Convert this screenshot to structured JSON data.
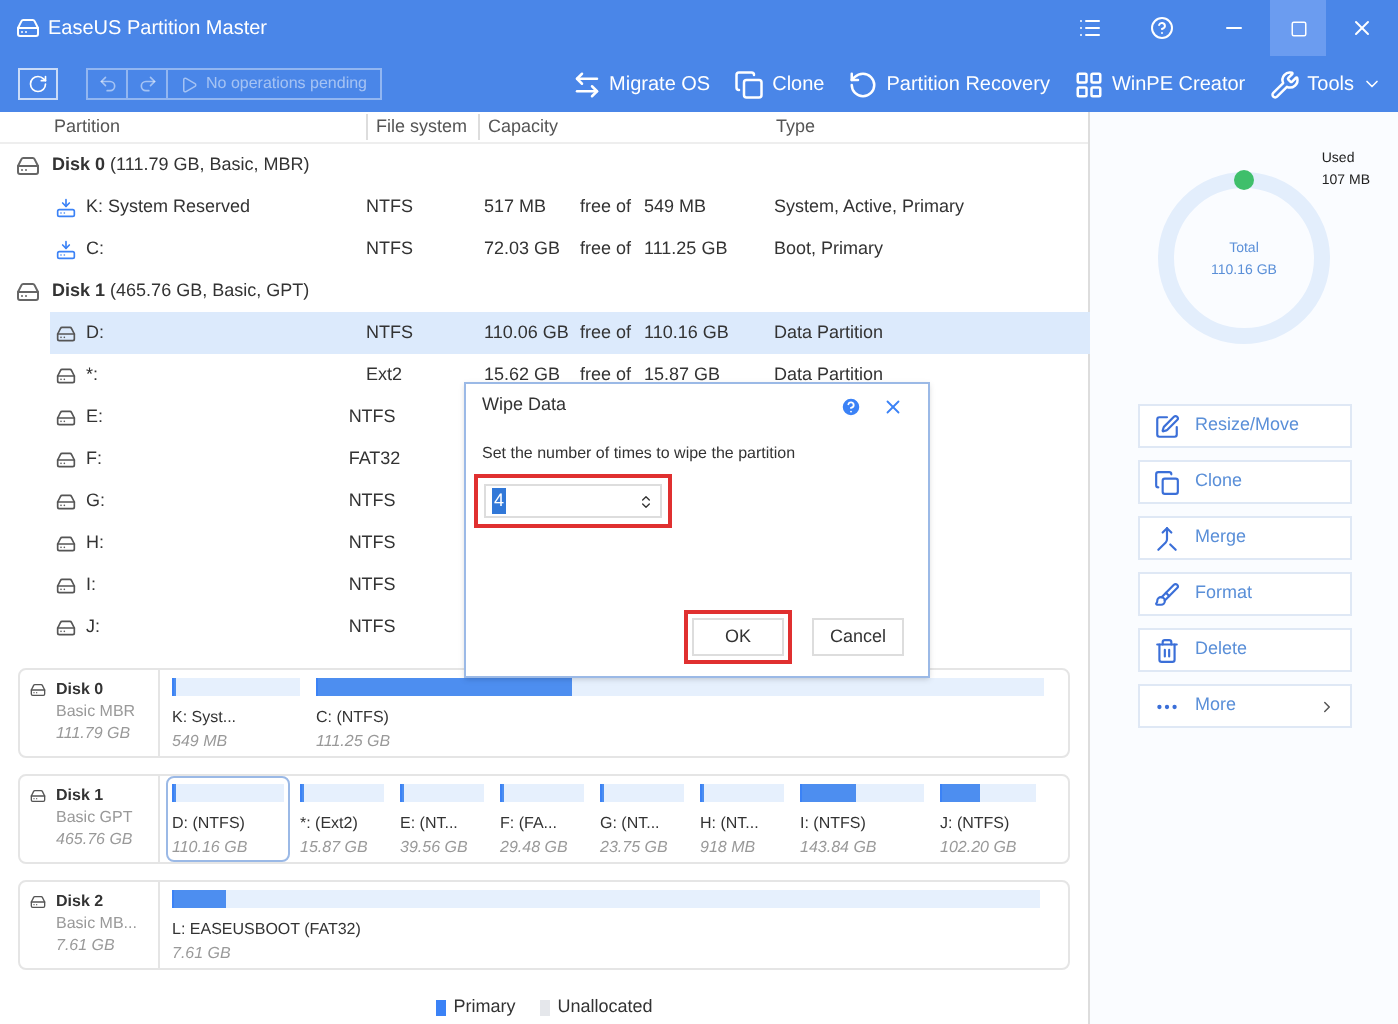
{
  "window": {
    "title": "EaseUS Partition Master"
  },
  "toolbar": {
    "status": "No operations pending",
    "actions": [
      {
        "label": "Migrate OS",
        "kind": "migrate"
      },
      {
        "label": "Clone",
        "kind": "clone"
      },
      {
        "label": "Partition Recovery",
        "kind": "recovery"
      },
      {
        "label": "WinPE Creator",
        "kind": "winpe"
      },
      {
        "label": "Tools",
        "kind": "tools"
      }
    ]
  },
  "table": {
    "columns": [
      "Partition",
      "File system",
      "Capacity",
      "Type"
    ],
    "disks": [
      {
        "name": "Disk 0",
        "info": "(111.79 GB, Basic, MBR)",
        "partitions": [
          {
            "name": "K: System Reserved",
            "kind": "system",
            "fs": "NTFS",
            "free": "517 MB",
            "free_of": "free of",
            "total": "549 MB",
            "type": "System, Active, Primary",
            "selected": false
          },
          {
            "name": "C:",
            "kind": "system",
            "fs": "NTFS",
            "free": "72.03 GB",
            "free_of": "free of",
            "total": "111.25 GB",
            "type": "Boot, Primary",
            "selected": false
          }
        ]
      },
      {
        "name": "Disk 1",
        "info": "(465.76 GB, Basic, GPT)",
        "partitions": [
          {
            "name": "D:",
            "kind": "drive",
            "fs": "NTFS",
            "free": "110.06 GB",
            "free_of": "free of",
            "total": "110.16 GB",
            "type": "Data Partition",
            "selected": true
          },
          {
            "name": "*:",
            "kind": "drive",
            "fs": "Ext2",
            "free": "15.62 GB",
            "free_of": "free of",
            "total": "15.87 GB",
            "type": "Data Partition",
            "selected": false
          },
          {
            "name": "E:",
            "kind": "drive",
            "fs": "NTFS",
            "selected": false
          },
          {
            "name": "F:",
            "kind": "drive",
            "fs": "FAT32",
            "selected": false
          },
          {
            "name": "G:",
            "kind": "drive",
            "fs": "NTFS",
            "selected": false
          },
          {
            "name": "H:",
            "kind": "drive",
            "fs": "NTFS",
            "selected": false
          },
          {
            "name": "I:",
            "kind": "drive",
            "fs": "NTFS",
            "selected": false
          },
          {
            "name": "J:",
            "kind": "drive",
            "fs": "NTFS",
            "selected": false
          }
        ]
      }
    ]
  },
  "dialog": {
    "title": "Wipe Data",
    "prompt": "Set the number of times to wipe the partition",
    "value": "4",
    "buttons": [
      "OK",
      "Cancel"
    ]
  },
  "disk_map": [
    {
      "name": "Disk 0",
      "style": "Basic MBR",
      "size": "111.79 GB",
      "partitions": [
        {
          "label": "K: Syst...",
          "size": "549 MB",
          "level": 0.02,
          "selected": false
        },
        {
          "label": "C:  (NTFS)",
          "size": "111.25 GB",
          "level": 0.35,
          "selected": false
        }
      ]
    },
    {
      "name": "Disk 1",
      "style": "Basic GPT",
      "size": "465.76 GB",
      "partitions": [
        {
          "label": "D:  (NTFS)",
          "size": "110.16 GB",
          "level": 0.005,
          "selected": true
        },
        {
          "label": "*:  (Ext2)",
          "size": "15.87 GB",
          "level": 0.01,
          "selected": false
        },
        {
          "label": "E:  (NT...",
          "size": "39.56 GB",
          "level": 0.01,
          "selected": false
        },
        {
          "label": "F:  (FA...",
          "size": "29.48 GB",
          "level": 0.01,
          "selected": false
        },
        {
          "label": "G:  (NT...",
          "size": "23.75 GB",
          "level": 0.01,
          "selected": false
        },
        {
          "label": "H:  (NT...",
          "size": "918 MB",
          "level": 0.01,
          "selected": false
        },
        {
          "label": "I:  (NTFS)",
          "size": "143.84 GB",
          "level": 0.45,
          "selected": false
        },
        {
          "label": "J:  (NTFS)",
          "size": "102.20 GB",
          "level": 0.4,
          "selected": false
        }
      ]
    },
    {
      "name": "Disk 2",
      "style": "Basic MB...",
      "size": "7.61 GB",
      "partitions": [
        {
          "label": "L: EASEUSBOOT (FAT32)",
          "size": "7.61 GB",
          "level": 0.06,
          "selected": false
        }
      ]
    }
  ],
  "legend": [
    {
      "label": "Primary",
      "color": "#3b82f6"
    },
    {
      "label": "Unallocated",
      "color": "#e5e7eb"
    }
  ],
  "usage": {
    "used_label": "Used",
    "used": "107 MB",
    "total_label": "Total",
    "total": "110.16 GB"
  },
  "operations": [
    {
      "label": "Resize/Move",
      "kind": "resize"
    },
    {
      "label": "Clone",
      "kind": "clone"
    },
    {
      "label": "Merge",
      "kind": "merge"
    },
    {
      "label": "Format",
      "kind": "format"
    },
    {
      "label": "Delete",
      "kind": "delete"
    },
    {
      "label": "More",
      "kind": "more"
    }
  ]
}
